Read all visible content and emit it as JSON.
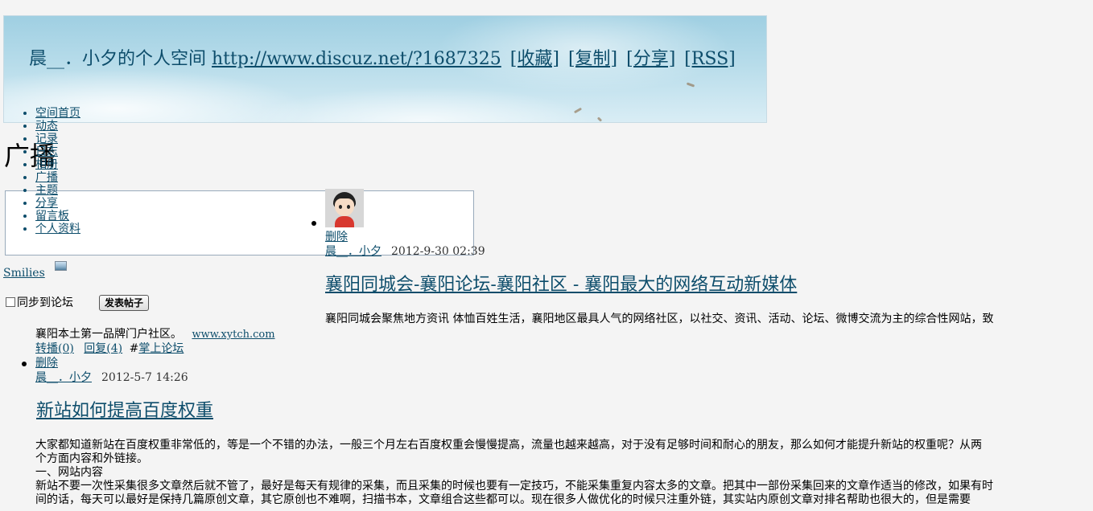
{
  "header": {
    "space_name": "晨__．小夕的个人空间",
    "space_url": "http://www.discuz.net/?1687325",
    "links": [
      "[收藏]",
      "[复制]",
      "[分享]",
      "[RSS]"
    ]
  },
  "nav": {
    "items": [
      "空间首页",
      "动态",
      "记录",
      "日志",
      "相册",
      "广播",
      "主题",
      "分享",
      "留言板",
      "个人资料"
    ]
  },
  "page_title": "广播",
  "composer": {
    "smilies_label": "Smilies",
    "sync_label": "同步到论坛",
    "publish_label": "发表帖子"
  },
  "feed": [
    {
      "delete_label": "删除",
      "author": "晨__．小夕",
      "time": "2012-9-30 02:39",
      "title": "襄阳同城会-襄阳论坛-襄阳社区 - 襄阳最大的网络互动新媒体",
      "excerpt": "襄阳同城会聚焦地方资讯 体恤百姓生活，襄阳地区最具人气的网络社区，以社交、资讯、活动、论坛、微博交流为主的综合性网站，致",
      "note": "襄阳本土第一品牌门户社区。",
      "link": "www.xytch.com",
      "repost_label": "转播(0)",
      "reply_label": "回复(4)",
      "tag_prefix": "#",
      "tag": "掌上论坛"
    },
    {
      "delete_label": "删除",
      "author": "晨__．小夕",
      "time": "2012-5-7 14:26",
      "title": "新站如何提高百度权重",
      "body_lines": [
        "大家都知道新站在百度权重非常低的，等是一个不错的办法，一般三个月左右百度权重会慢慢提高，流量也越来越高，对于没有足够时间和耐心的朋友，那么如何才能提升新站的权重呢？从两",
        "个方面内容和外链接。",
        "一、网站内容",
        "新站不要一次性采集很多文章然后就不管了，最好是每天有规律的采集，而且采集的时候也要有一定技巧，不能采集重复内容太多的文章。把其中一部份采集回来的文章作适当的修改，如果有时",
        "间的话，每天可以最好是保持几篇原创文章，其它原创也不难啊，扫描书本，文章组合这些都可以。现在很多人做优化的时候只注重外链，其实站内原创文章对排名帮助也很大的，但是需要"
      ]
    }
  ],
  "colors": {
    "link": "#0d4d6b",
    "page_background": "#f4f4f4",
    "banner_sky": "#b7dcea"
  }
}
